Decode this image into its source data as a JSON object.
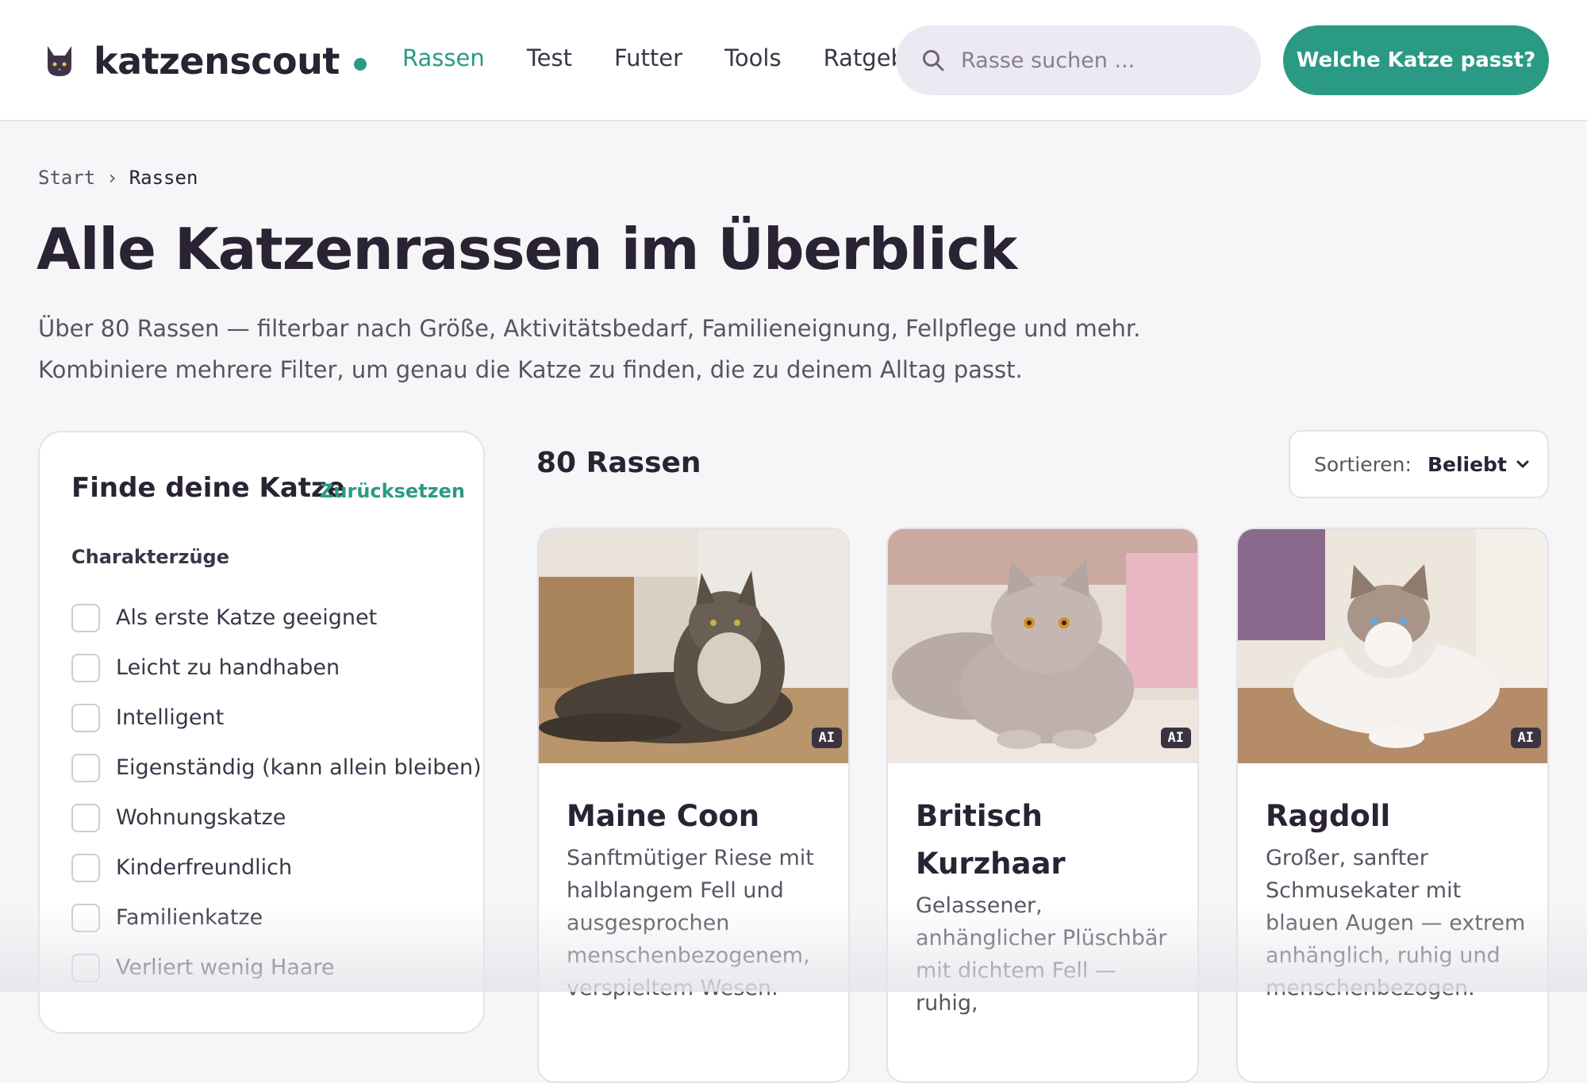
{
  "header": {
    "logo_text": "katzenscout",
    "brand_color": "#2b9a84",
    "nav": [
      "Rassen",
      "Test",
      "Futter",
      "Tools",
      "Ratgeber"
    ],
    "active_nav": "Rassen",
    "search_placeholder": "Rasse suchen ...",
    "cta_label": "Welche Katze passt?"
  },
  "breadcrumb": {
    "items": [
      "Start",
      "Rassen"
    ],
    "separator": "›"
  },
  "hero": {
    "title": "Alle Katzenrassen im Überblick",
    "intro": "Über 80 Rassen — filterbar nach Größe, Aktivitätsbedarf, Familieneignung, Fellpflege und mehr. Kombiniere mehrere Filter, um genau die Katze zu finden, die zu deinem Alltag passt."
  },
  "filter": {
    "title": "Finde deine Katze",
    "reset_label": "Zurücksetzen",
    "group_title": "Charakterzüge",
    "options": [
      "Als erste Katze geeignet",
      "Leicht zu handhaben",
      "Intelligent",
      "Eigenständig (kann allein bleiben)",
      "Wohnungskatze",
      "Kinderfreundlich",
      "Familienkatze",
      "Verliert wenig Haare"
    ]
  },
  "results": {
    "count_label": "80 Rassen",
    "sort_label": "Sortieren:",
    "sort_value": "Beliebt"
  },
  "cards": [
    {
      "name": "Maine Coon",
      "badge": "AI",
      "desc": "Sanftmütiger Riese mit halblangem Fell und ausgesprochen menschenbezogenem, verspieltem Wesen."
    },
    {
      "name": "Britisch Kurzhaar",
      "badge": "AI",
      "desc": "Gelassener, anhänglicher Plüschbär mit dichtem Fell — ruhig,"
    },
    {
      "name": "Ragdoll",
      "badge": "AI",
      "desc": "Großer, sanfter Schmusekater mit blauen Augen — extrem anhänglich, ruhig und menschenbezogen."
    }
  ],
  "icons": {
    "logo": "cat-face-icon",
    "search": "search-icon",
    "sort": "chevron-down-icon"
  }
}
